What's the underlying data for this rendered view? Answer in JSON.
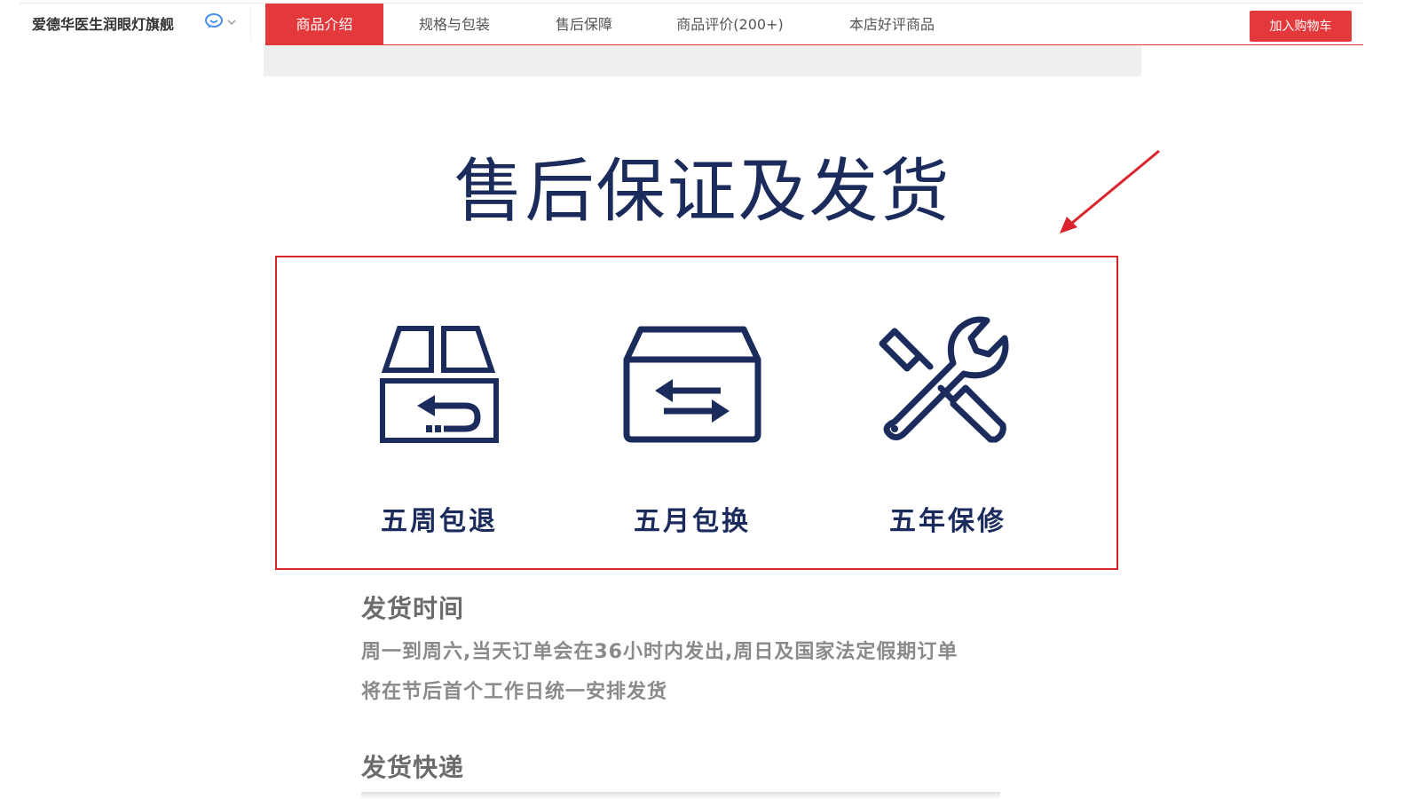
{
  "header": {
    "store_name": "爱德华医生润眼灯旗舰",
    "tabs": [
      {
        "label": "商品介绍",
        "active": true
      },
      {
        "label": "规格与包装",
        "active": false
      },
      {
        "label": "售后保障",
        "active": false
      },
      {
        "label": "商品评价(200+)",
        "active": false
      },
      {
        "label": "本店好评商品",
        "active": false
      }
    ],
    "cart_button": "加入购物车"
  },
  "colors": {
    "accent_red": "#e4393c",
    "navy": "#1b2c5c",
    "gray_text": "#8a8a8a"
  },
  "content": {
    "heading": "售后保证及发货",
    "guarantees": [
      {
        "icon": "box-return-icon",
        "label": "五周包退"
      },
      {
        "icon": "box-exchange-icon",
        "label": "五月包换"
      },
      {
        "icon": "repair-tools-icon",
        "label": "五年保修"
      }
    ],
    "shipping_time": {
      "title": "发货时间",
      "lines": [
        "周一到周六,当天订单会在36小时内发出,周日及国家法定假期订单",
        "将在节后首个工作日统一安排发货"
      ]
    },
    "shipping_express": {
      "title": "发货快递"
    }
  }
}
